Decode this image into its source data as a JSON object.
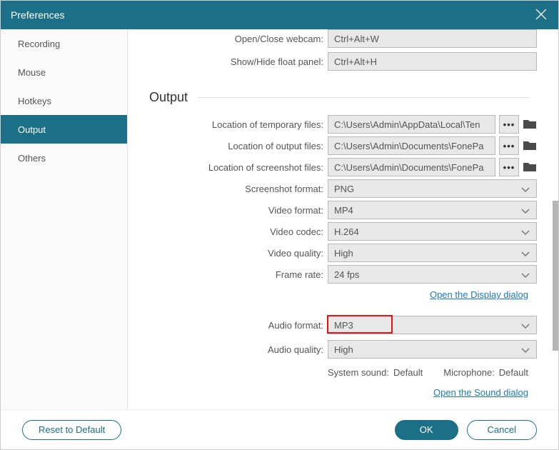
{
  "title": "Preferences",
  "sidebar": {
    "items": [
      {
        "label": "Recording"
      },
      {
        "label": "Mouse"
      },
      {
        "label": "Hotkeys"
      },
      {
        "label": "Output"
      },
      {
        "label": "Others"
      }
    ],
    "active": 3
  },
  "hotkeys_partial": {
    "open_close_webcam_label": "Open/Close webcam:",
    "open_close_webcam_value": "Ctrl+Alt+W",
    "show_hide_float_label": "Show/Hide float panel:",
    "show_hide_float_value": "Ctrl+Alt+H"
  },
  "output": {
    "section_title": "Output",
    "temp_files_label": "Location of temporary files:",
    "temp_files_value": "C:\\Users\\Admin\\AppData\\Local\\Ten",
    "output_files_label": "Location of output files:",
    "output_files_value": "C:\\Users\\Admin\\Documents\\FonePa",
    "screenshot_files_label": "Location of screenshot files:",
    "screenshot_files_value": "C:\\Users\\Admin\\Documents\\FonePa",
    "screenshot_format_label": "Screenshot format:",
    "screenshot_format_value": "PNG",
    "video_format_label": "Video format:",
    "video_format_value": "MP4",
    "video_codec_label": "Video codec:",
    "video_codec_value": "H.264",
    "video_quality_label": "Video quality:",
    "video_quality_value": "High",
    "frame_rate_label": "Frame rate:",
    "frame_rate_value": "24 fps",
    "display_link": "Open the Display dialog",
    "audio_format_label": "Audio format:",
    "audio_format_value": "MP3",
    "audio_quality_label": "Audio quality:",
    "audio_quality_value": "High",
    "system_sound_label": "System sound:",
    "system_sound_value": "Default",
    "microphone_label": "Microphone:",
    "microphone_value": "Default",
    "sound_link": "Open the Sound dialog",
    "browse_btn": "•••"
  },
  "footer": {
    "reset": "Reset to Default",
    "ok": "OK",
    "cancel": "Cancel"
  }
}
